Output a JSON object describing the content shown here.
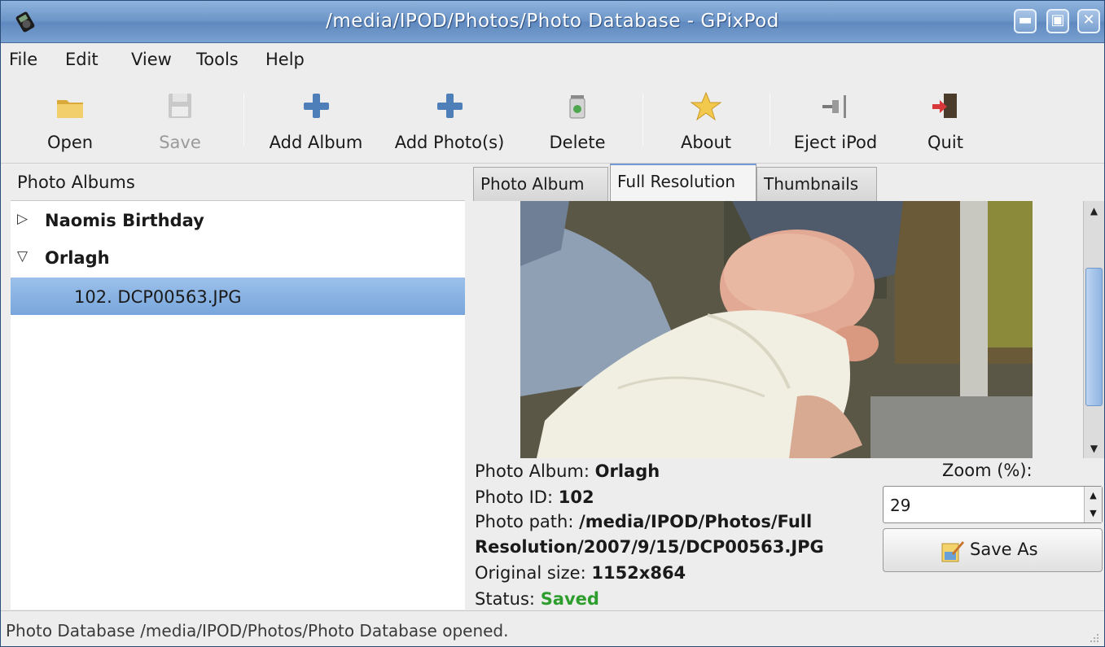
{
  "window": {
    "title": "/media/IPOD/Photos/Photo Database - GPixPod",
    "icon": "ipod-app-icon",
    "buttons": {
      "minimize": "minimize-icon",
      "maximize": "maximize-icon",
      "close": "close-icon"
    }
  },
  "menubar": {
    "items": [
      {
        "label": "File",
        "mnemonic": "F"
      },
      {
        "label": "Edit",
        "mnemonic": "E"
      },
      {
        "label": "View",
        "mnemonic": "V"
      },
      {
        "label": "Tools",
        "mnemonic": "T"
      },
      {
        "label": "Help",
        "mnemonic": "H"
      }
    ]
  },
  "toolbar": {
    "buttons": [
      {
        "label": "Open",
        "icon": "folder-icon",
        "enabled": true
      },
      {
        "label": "Save",
        "icon": "floppy-icon",
        "enabled": false
      },
      {
        "label": "Add Album",
        "icon": "plus-icon",
        "enabled": true
      },
      {
        "label": "Add Photo(s)",
        "icon": "plus-icon",
        "enabled": true
      },
      {
        "label": "Delete",
        "icon": "trash-icon",
        "enabled": true
      },
      {
        "label": "About",
        "icon": "star-icon",
        "enabled": true
      },
      {
        "label": "Eject iPod",
        "icon": "plug-icon",
        "enabled": true
      },
      {
        "label": "Quit",
        "icon": "exit-door-icon",
        "enabled": true
      }
    ]
  },
  "albums_panel": {
    "header": "Photo Albums",
    "tree": [
      {
        "label": "Naomis Birthday",
        "expanded": false,
        "bold": true,
        "level": 0
      },
      {
        "label": "Orlagh",
        "expanded": true,
        "bold": true,
        "level": 0
      },
      {
        "label": "102. DCP00563.JPG",
        "selected": true,
        "level": 1
      }
    ]
  },
  "tabs": [
    {
      "label": "Photo Album",
      "active": false
    },
    {
      "label": "Full Resolution",
      "active": true
    },
    {
      "label": "Thumbnails",
      "active": false
    }
  ],
  "photo_info": {
    "album_label": "Photo Album:",
    "album_value": "Orlagh",
    "id_label": "Photo ID:",
    "id_value": "102",
    "path_label": "Photo path:",
    "path_value_line1": "/media/IPOD/Photos/Full",
    "path_value_line2": "Resolution/2007/9/15/DCP00563.JPG",
    "size_label": "Original size:",
    "size_value": "1152x864",
    "status_label": "Status:",
    "status_value": "Saved",
    "status_color": "#2d9e2d"
  },
  "zoom": {
    "label": "Zoom (%):",
    "value": "29"
  },
  "save_as_button": {
    "label": "Save As",
    "mnemonic": "A",
    "icon": "save-as-icon"
  },
  "statusbar": {
    "text": "Photo Database /media/IPOD/Photos/Photo Database opened."
  },
  "colors": {
    "titlebar": "#6c95c8",
    "selection": "#78a6dc",
    "accent": "#6f9bd2"
  }
}
